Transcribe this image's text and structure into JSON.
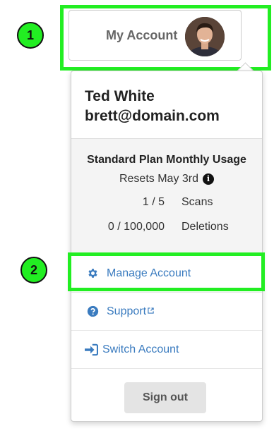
{
  "callouts": [
    "1",
    "2"
  ],
  "account_button": {
    "label": "My Account"
  },
  "user": {
    "name": "Ted White",
    "email": "brett@domain.com"
  },
  "usage": {
    "title": "Standard Plan Monthly Usage",
    "reset": "Resets May 3rd",
    "info_glyph": "i",
    "rows": [
      {
        "value": "1 / 5",
        "label": "Scans"
      },
      {
        "value": "0 / 100,000",
        "label": "Deletions"
      }
    ]
  },
  "menu": {
    "manage": "Manage Account",
    "support": "Support",
    "switch": "Switch Account"
  },
  "signout": "Sign out",
  "colors": {
    "highlight": "#22ee22",
    "link": "#3a7bbf"
  }
}
